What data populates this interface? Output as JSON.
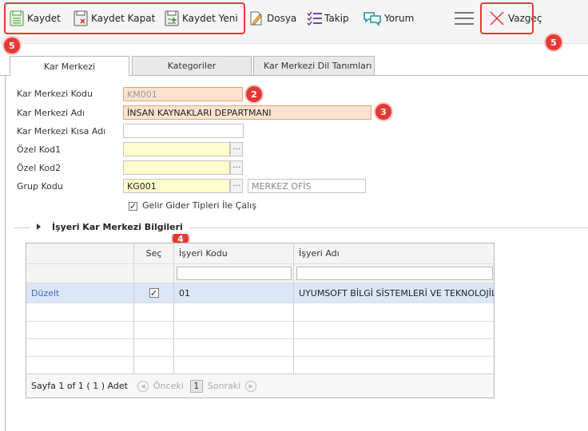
{
  "toolbar": {
    "save": "Kaydet",
    "save_close": "Kaydet Kapat",
    "save_new": "Kaydet Yeni",
    "file": "Dosya",
    "follow": "Takip",
    "comment": "Yorum",
    "cancel": "Vazgeç"
  },
  "badges": {
    "b1": "5",
    "b2": "2",
    "b3": "3",
    "b4": "4",
    "b5": "5"
  },
  "tabs": [
    {
      "label": "Kar Merkezi"
    },
    {
      "label": "Kategoriler"
    },
    {
      "label": "Kar Merkezi Dil Tanımları"
    }
  ],
  "form": {
    "code_label": "Kar Merkezi Kodu",
    "code_value": "KM001",
    "name_label": "Kar Merkezi Adı",
    "name_value": "İNSAN KAYNAKLARI DEPARTMANI",
    "short_label": "Kar Merkezi Kısa Adı",
    "short_value": "",
    "special1_label": "Özel Kod1",
    "special1_value": "",
    "special2_label": "Özel Kod2",
    "special2_value": "",
    "group_label": "Grup Kodu",
    "group_value": "KG001",
    "group_desc": "MERKEZ OFİS",
    "ellipsis": "···",
    "checkbox_label": "Gelir Gider Tipleri İle Çalış",
    "checkbox_checked": true
  },
  "section": {
    "title": "İşyeri Kar Merkezi Bilgileri"
  },
  "grid": {
    "columns": [
      "",
      "Seç",
      "İşyeri Kodu",
      "İşyeri Adı"
    ],
    "rows": [
      {
        "action": "Düzelt",
        "selected": true,
        "code": "01",
        "name": "UYUMSOFT BİLGİ SİSTEMLERİ VE TEKNOLOJİLERİ"
      }
    ],
    "checkmark": "✓",
    "pager": {
      "summary": "Sayfa 1 of 1 ( 1 ) Adet",
      "prev": "Önceki",
      "page": "1",
      "next": "Sonraki"
    }
  },
  "colors": {
    "accent": "#e53935",
    "peach": "#fde3cf",
    "yellow": "#fffccd",
    "row_selected": "#dbe6f8",
    "link": "#3b6cc0"
  }
}
